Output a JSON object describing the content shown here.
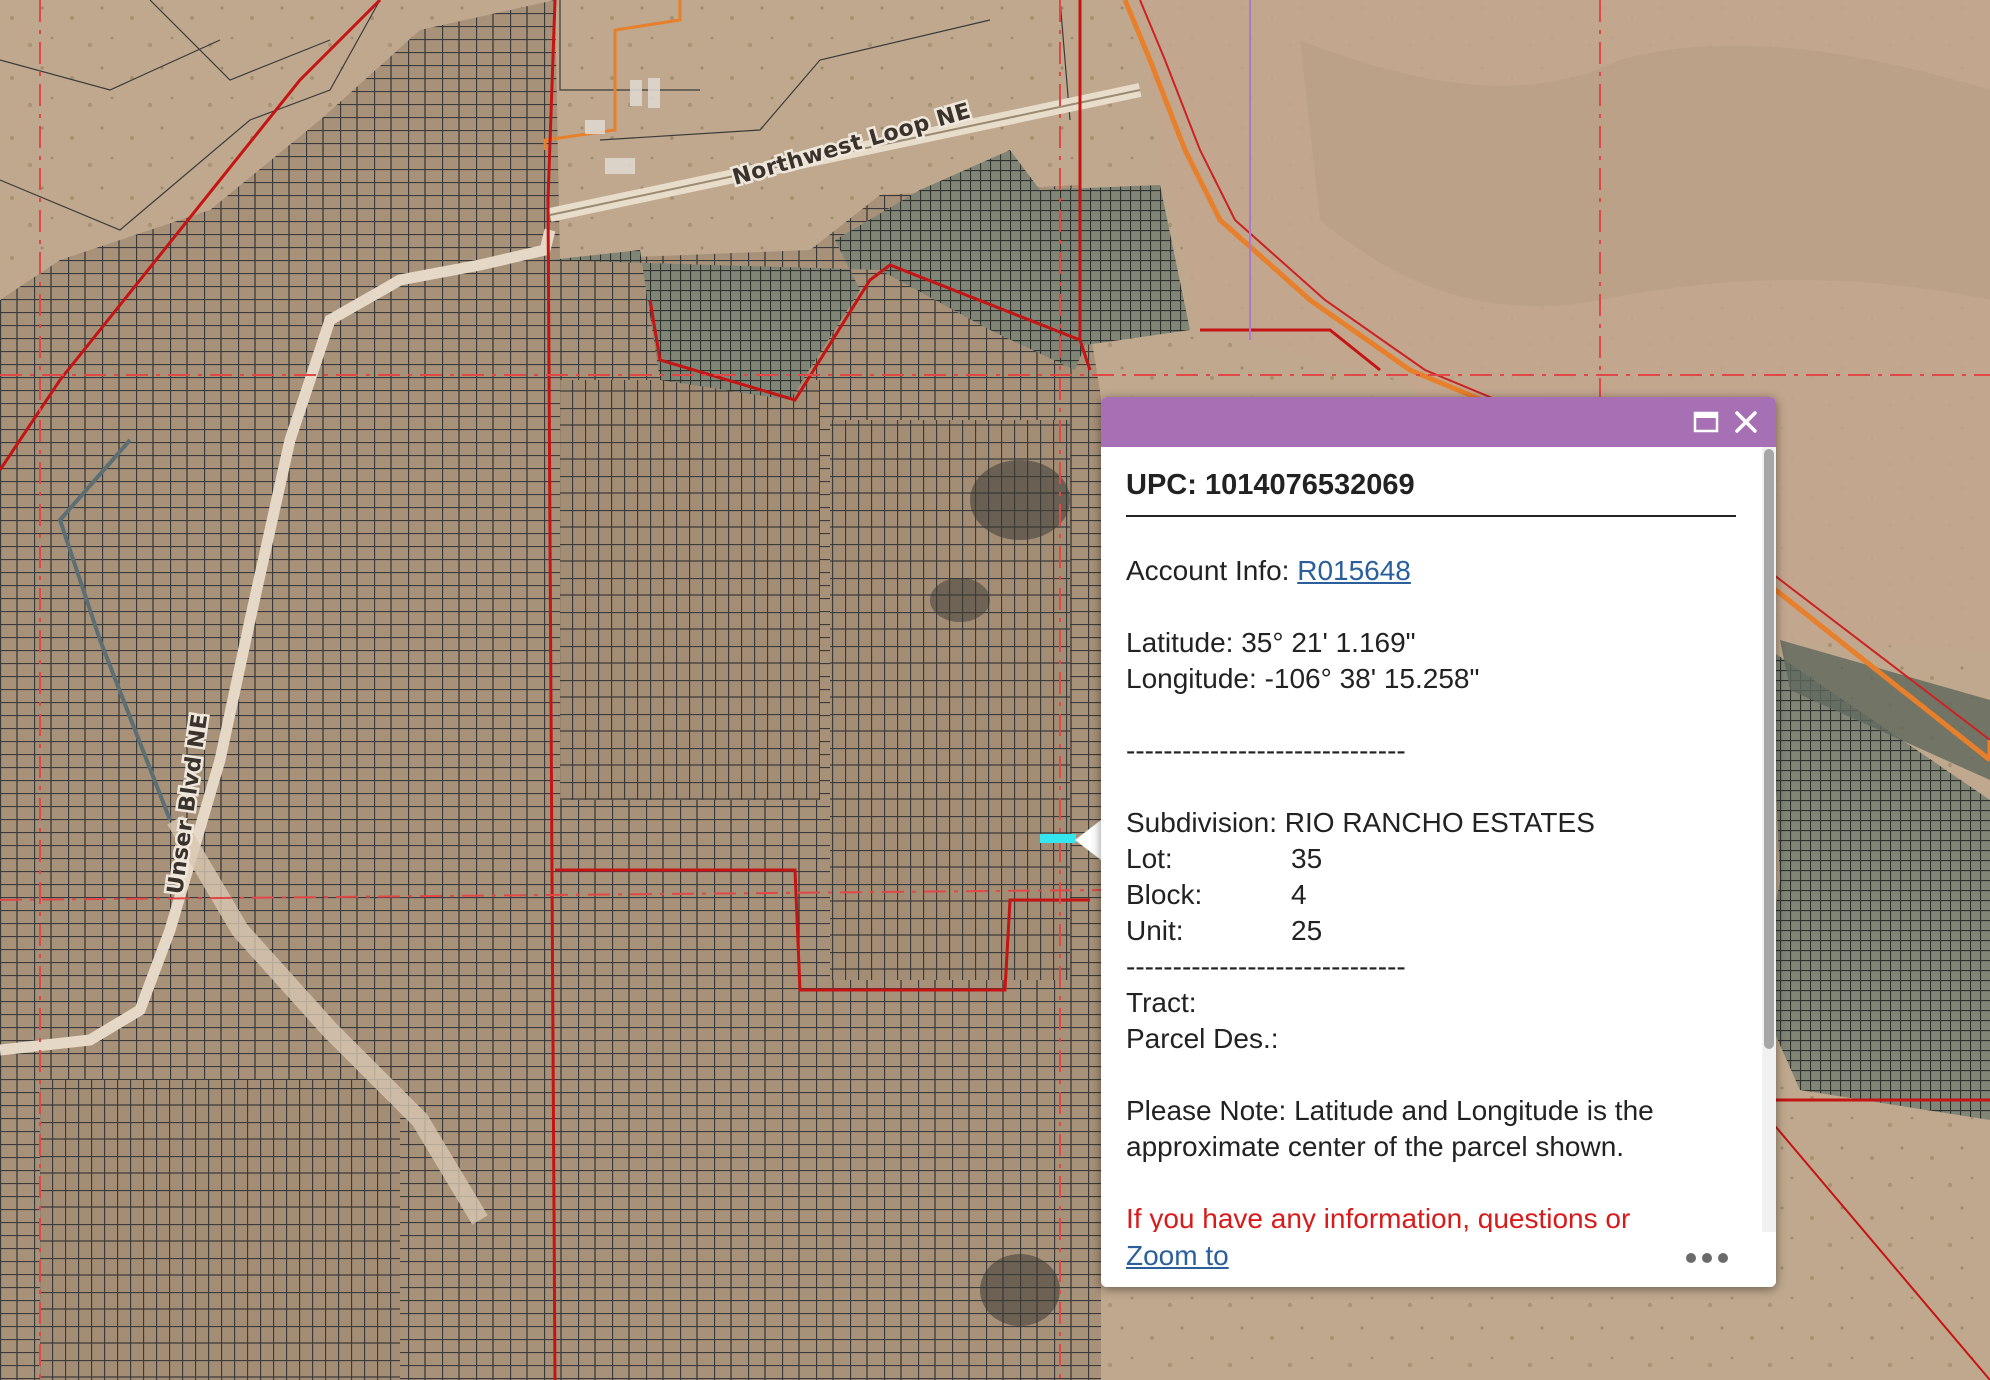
{
  "map": {
    "road_labels": [
      "Northwest Loop NE",
      "Unser Blvd NE"
    ]
  },
  "popup": {
    "title": "UPC: 1014076532069",
    "account_label": "Account Info: ",
    "account_link": "R015648",
    "latitude": "Latitude: 35° 21' 1.169\"",
    "longitude": "Longitude: -106° 38' 15.258\"",
    "separator": "------------------------------",
    "subdivision": "Subdivision: RIO RANCHO ESTATES",
    "fields": [
      {
        "key": "Lot:",
        "value": "35"
      },
      {
        "key": "Block:",
        "value": "4"
      },
      {
        "key": "Unit:",
        "value": "25"
      }
    ],
    "tract_label": "Tract:",
    "parcel_label": "Parcel Des.:",
    "note": "Please Note: Latitude and Longitude is the approximate center of the parcel shown.",
    "contact_text": "If you have any information, questions or concerns about this parcel, please contact",
    "zoom_label": "Zoom to"
  },
  "colors": {
    "header": "#a770b4",
    "link": "#2a5f9c",
    "alert": "#d91a1a",
    "parcel_line": "#3a3a3a",
    "boundary_red": "#c51414",
    "highlight": "#33e6f0"
  },
  "icons": [
    "maximize-icon",
    "close-icon",
    "more-icon"
  ]
}
